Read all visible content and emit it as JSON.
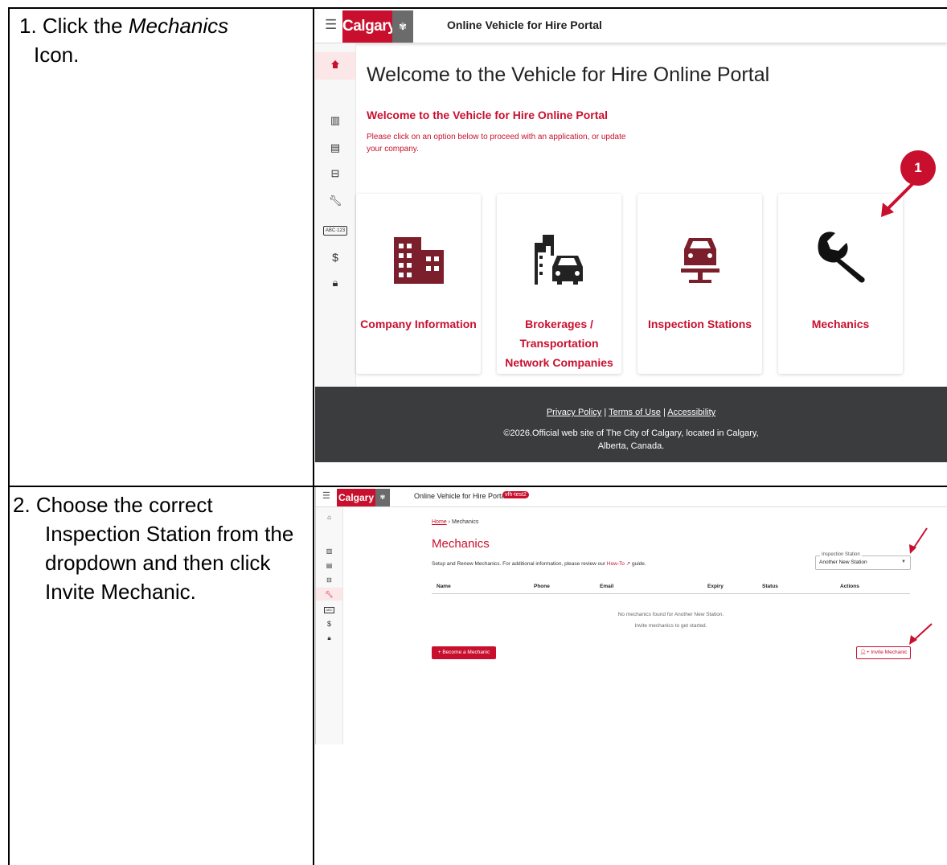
{
  "steps": [
    {
      "pre": "1.  Click the ",
      "em": "Mechanics",
      "post": " Icon."
    },
    {
      "text": "2. Choose the correct Inspection Station from the dropdown and then click Invite Mechanic."
    }
  ],
  "shot1": {
    "menu_icon": "menu-icon",
    "brand": "Calgary",
    "crest": "crest",
    "portal_title": "Online Vehicle for Hire Portal",
    "welcome_heading": "Welcome to the Vehicle for Hire Online Portal",
    "welcome_subheading": "Welcome to the Vehicle for Hire Online Portal",
    "welcome_text": "Please click on an option below to proceed with an application, or update your company.",
    "cards": [
      {
        "label": "Company Information",
        "icon": "building-icon"
      },
      {
        "label": "Brokerages / Transportation Network Companies",
        "icon": "city-car-icon"
      },
      {
        "label": "Inspection Stations",
        "icon": "car-lift-icon"
      },
      {
        "label": "Mechanics",
        "icon": "wrench-icon"
      }
    ],
    "callout_number": "1",
    "footer": {
      "privacy": "Privacy Policy",
      "terms": "Terms of Use",
      "accessibility": "Accessibility",
      "separator": "|",
      "copyright": "©2026.Official web site of The City of Calgary, located in Calgary, Alberta, Canada."
    },
    "sidebar_icons": [
      "home-icon",
      "building-icon",
      "city-car-icon",
      "car-lift-icon",
      "wrench-icon",
      "licence-plate-icon",
      "dollar-icon",
      "lock-icon"
    ]
  },
  "shot2": {
    "brand": "Calgary",
    "portal_title": "Online Vehicle for Hire Portal",
    "env_badge": "vfh-test2",
    "breadcrumb": {
      "home": "Home",
      "sep": "›",
      "current": "Mechanics"
    },
    "title": "Mechanics",
    "setup_text": "Setup and Renew Mechanics. For additional information, please review our ",
    "howto_link": "How-To",
    "setup_tail": " guide.",
    "select": {
      "label": "Inspection Station",
      "value": "Another New Station"
    },
    "table_headers": [
      "Name",
      "Phone",
      "Email",
      "Expiry",
      "Status",
      "Actions"
    ],
    "empty_line1": "No mechanics found for Another New Station.",
    "empty_line2": "Invite mechanics to get started.",
    "become_button": "+  Become a Mechanic",
    "invite_button": "Invite Mechanic"
  },
  "colors": {
    "brand_red": "#c8102e",
    "footer": "#3a3c3d",
    "icon_dark_red": "#7a1f2b"
  }
}
